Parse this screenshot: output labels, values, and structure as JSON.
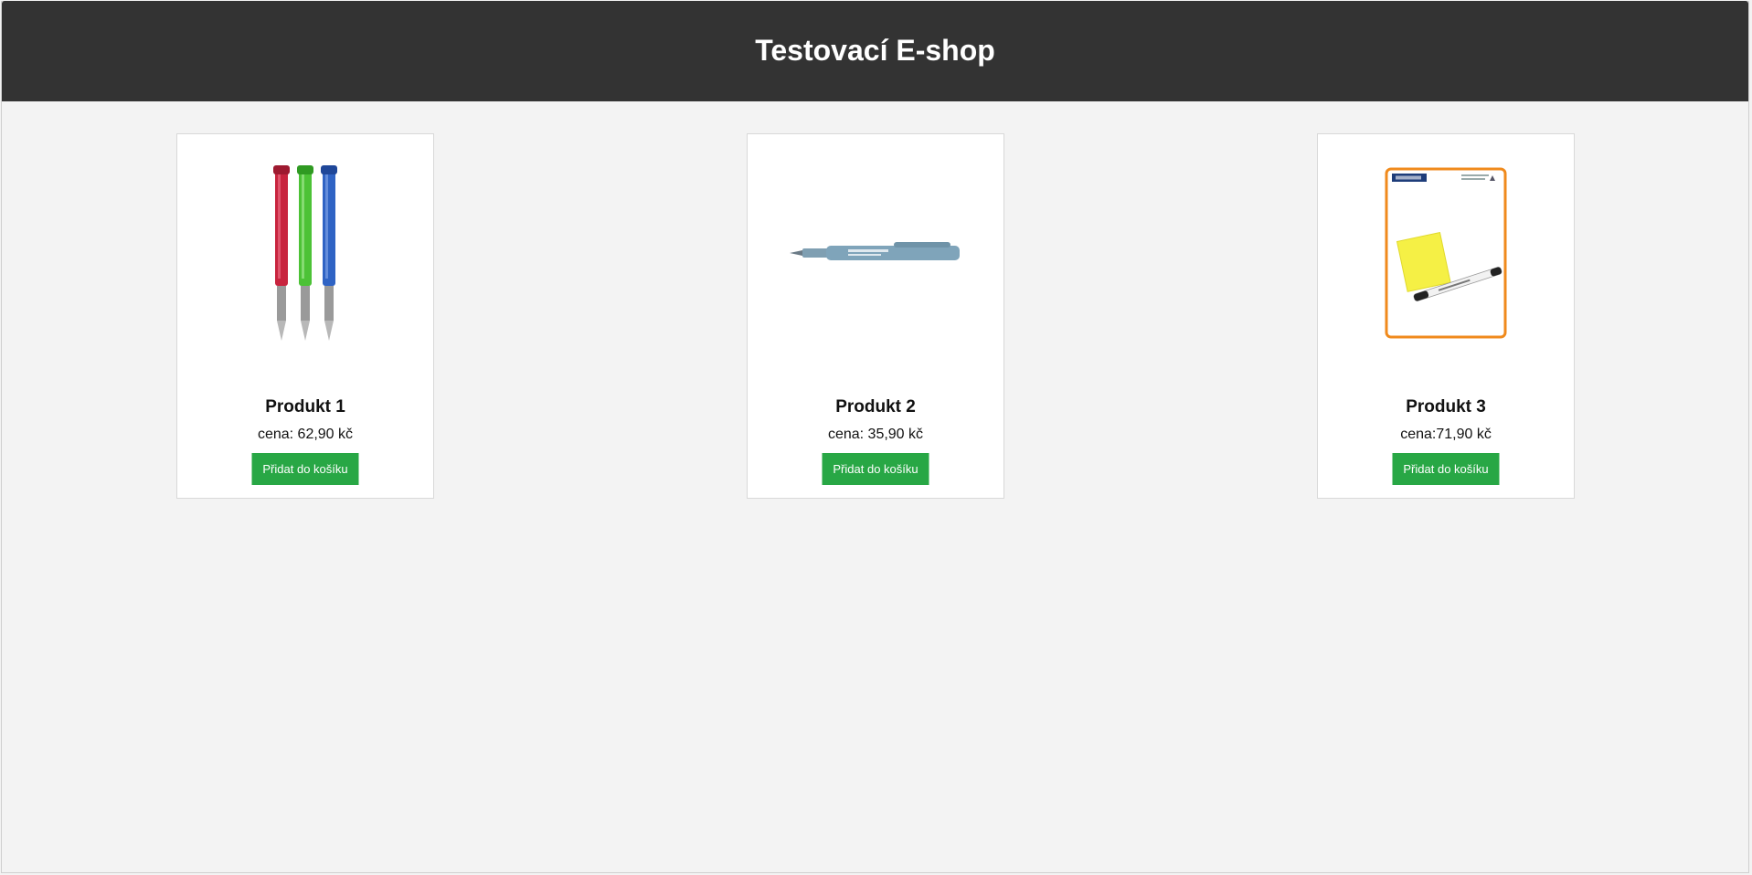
{
  "header": {
    "title": "Testovací E-shop"
  },
  "colors": {
    "header_bg": "#333333",
    "page_bg": "#f3f3f3",
    "button_bg": "#28a745"
  },
  "products": [
    {
      "name": "Produkt 1",
      "price": "cena: 62,90 kč",
      "button_label": "Přidat do košíku",
      "image": "fountain-pens-three-colors"
    },
    {
      "name": "Produkt 2",
      "price": "cena: 35,90 kč",
      "button_label": "Přidat do košíku",
      "image": "blue-pen"
    },
    {
      "name": "Produkt 3",
      "price": "cena:71,90 kč",
      "button_label": "Přidat do košíku",
      "image": "sticky-note-and-marker-pack"
    }
  ]
}
